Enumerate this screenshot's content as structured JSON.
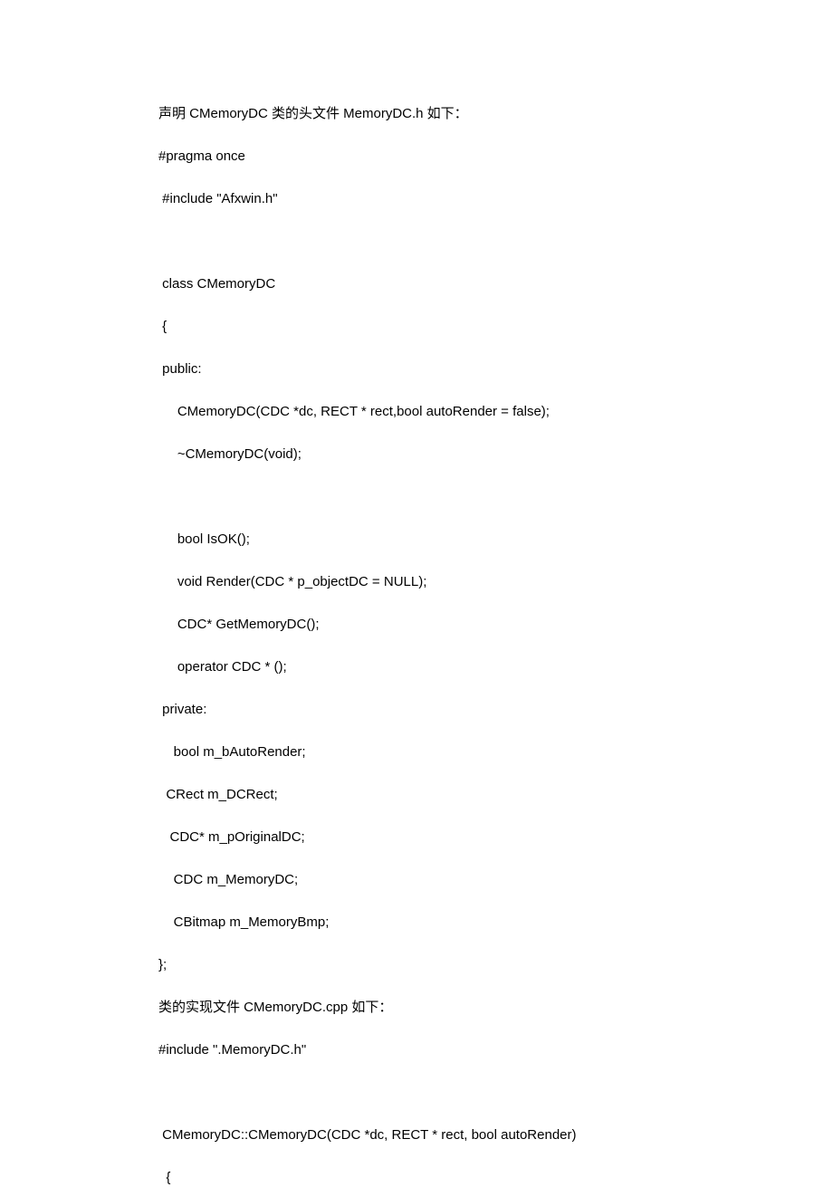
{
  "lines": [
    {
      "text": "声明 CMemoryDC 类的头文件 MemoryDC.h 如下：",
      "indent": 0,
      "cn": true
    },
    {
      "text": "#pragma once",
      "indent": 0
    },
    {
      "text": " #include \"Afxwin.h\"",
      "indent": 0
    },
    {
      "text": "",
      "indent": 0,
      "blank": true
    },
    {
      "text": " class CMemoryDC",
      "indent": 0
    },
    {
      "text": " {",
      "indent": 0
    },
    {
      "text": " public:",
      "indent": 0
    },
    {
      "text": "     CMemoryDC(CDC *dc, RECT * rect,bool autoRender = false);",
      "indent": 0
    },
    {
      "text": "     ~CMemoryDC(void);",
      "indent": 0
    },
    {
      "text": "",
      "indent": 0,
      "blank": true
    },
    {
      "text": "     bool IsOK();",
      "indent": 0
    },
    {
      "text": "     void Render(CDC * p_objectDC = NULL);",
      "indent": 0
    },
    {
      "text": "     CDC* GetMemoryDC();",
      "indent": 0
    },
    {
      "text": "     operator CDC * ();",
      "indent": 0
    },
    {
      "text": " private:",
      "indent": 0
    },
    {
      "text": "    bool m_bAutoRender;",
      "indent": 0
    },
    {
      "text": "  CRect m_DCRect;",
      "indent": 0
    },
    {
      "text": "   CDC* m_pOriginalDC;",
      "indent": 0
    },
    {
      "text": "    CDC m_MemoryDC;",
      "indent": 0
    },
    {
      "text": "    CBitmap m_MemoryBmp;",
      "indent": 0
    },
    {
      "text": "};",
      "indent": 0
    },
    {
      "text": "类的实现文件 CMemoryDC.cpp 如下：",
      "indent": 0,
      "cn": true
    },
    {
      "text": "#include \".MemoryDC.h\"",
      "indent": 0
    },
    {
      "text": "",
      "indent": 0,
      "blank": true
    },
    {
      "text": " CMemoryDC::CMemoryDC(CDC *dc, RECT * rect, bool autoRender)",
      "indent": 0
    },
    {
      "text": "  {",
      "indent": 0
    }
  ]
}
